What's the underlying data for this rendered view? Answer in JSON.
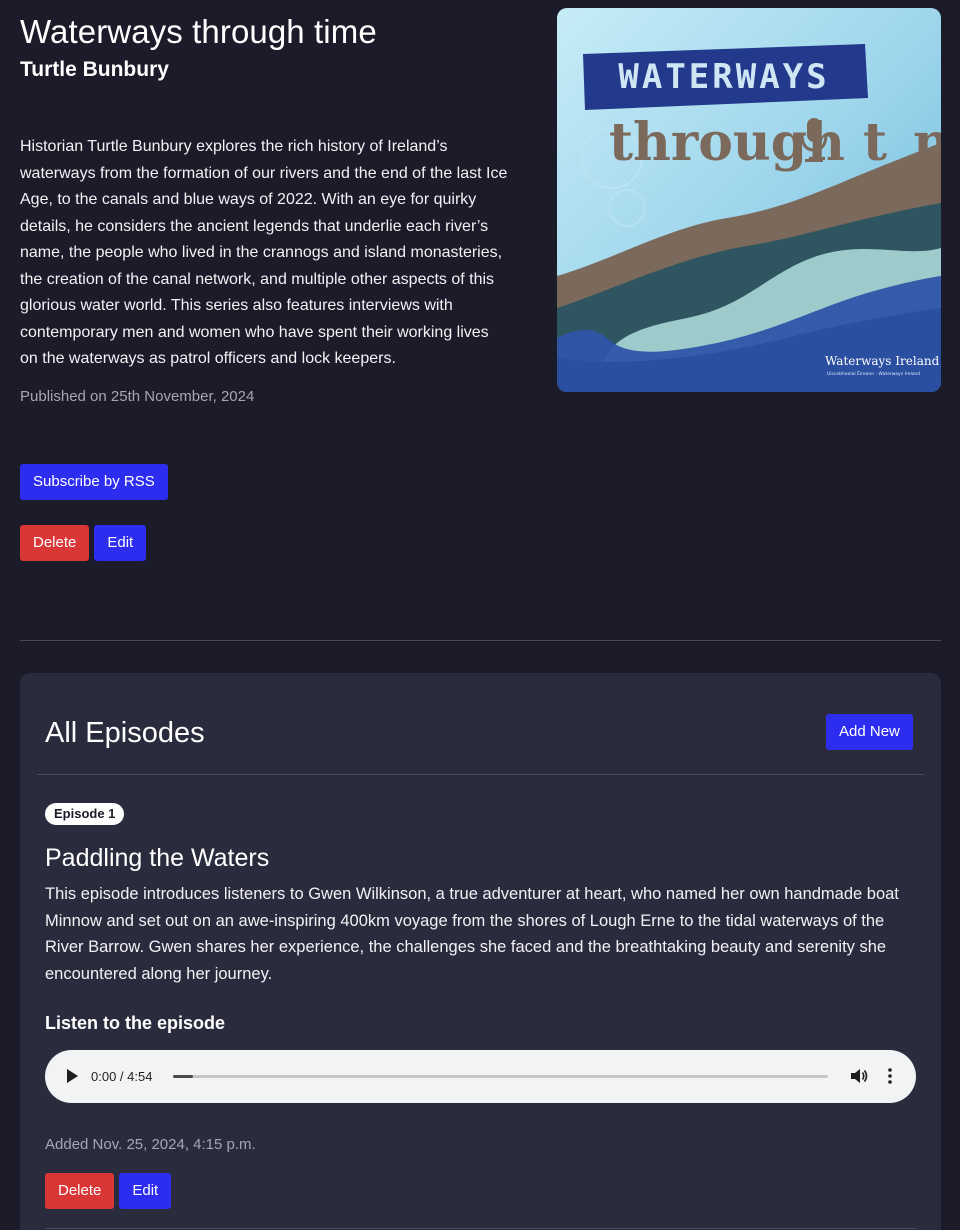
{
  "podcast": {
    "title": "Waterways through time",
    "author": "Turtle Bunbury",
    "description": "Historian Turtle Bunbury explores the rich history of Ireland’s waterways from the formation of our rivers and the end of the last Ice Age, to the canals and blue ways of 2022. With an eye for quirky details, he considers the ancient legends that underlie each river’s name, the people who lived in the crannogs and island monasteries, the creation of the canal network, and multiple other aspects of this glorious water world. This series also features interviews with contemporary men and women who have spent their working lives on the waterways as patrol officers and lock keepers.",
    "published": "Published on 25th November, 2024",
    "subscribe_label": "Subscribe by RSS",
    "delete_label": "Delete",
    "edit_label": "Edit"
  },
  "cover": {
    "banner_text": "WATERWAYS",
    "title_text": "through time",
    "title_part1": "through t",
    "title_part2": "me",
    "logo_text": "Waterways Ireland",
    "logo_subtext": "Uiscebhealaí Éireann · Waterways Ireland",
    "colors": {
      "water_light": "#a9dcef",
      "banner": "#233a8c",
      "brown": "#7b6a5c",
      "teal_dark": "#2e5560",
      "blue": "#2f55a8"
    }
  },
  "episodes": {
    "heading": "All Episodes",
    "add_new_label": "Add New",
    "items": [
      {
        "badge": "Episode 1",
        "title": "Paddling the Waters",
        "description": "This episode introduces listeners to Gwen Wilkinson, a true adventurer at heart, who named her own handmade boat Minnow and set out on an awe-inspiring 400km voyage from the shores of Lough Erne to the tidal waterways of the River Barrow. Gwen shares her experience, the challenges she faced and the breathtaking beauty and serenity she encountered along her journey.",
        "listen_label": "Listen to the episode",
        "audio_time": "0:00 / 4:54",
        "audio_progress": 0.03,
        "added": "Added Nov. 25, 2024, 4:15 p.m.",
        "delete_label": "Delete",
        "edit_label": "Edit"
      }
    ]
  }
}
